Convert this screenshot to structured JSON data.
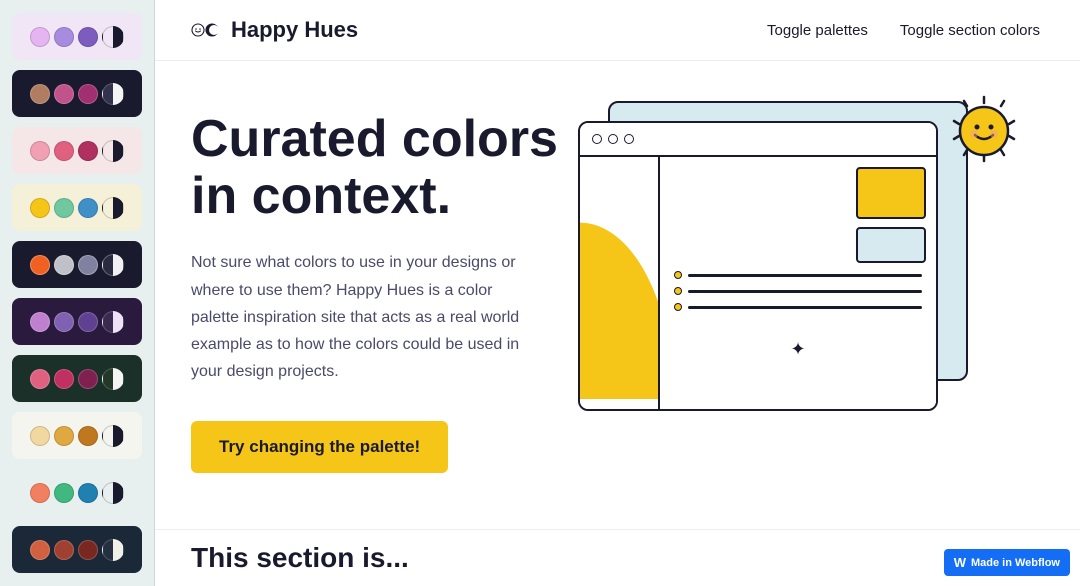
{
  "app": {
    "title": "Happy Hues",
    "logo_alt": "Happy Hues logo"
  },
  "header": {
    "toggle_palettes": "Toggle palettes",
    "toggle_colors": "Toggle section colors"
  },
  "hero": {
    "title_line1": "Curated colors",
    "title_line2": "in context.",
    "description": "Not sure what colors to use in your designs or where to use them? Happy Hues is a color palette inspiration site that acts as a real world example as to how the colors could be used in your design projects.",
    "cta_label": "Try changing the palette!"
  },
  "bottom": {
    "title": "This section is..."
  },
  "webflow_badge": "Made in Webflow",
  "palettes": [
    {
      "id": 1,
      "bg": "#f0e6f6",
      "swatches": [
        "#e4b5f0",
        "#a78bde",
        "#7c5cbf",
        "#1a1a2e"
      ],
      "active": false
    },
    {
      "id": 2,
      "bg": "#1a1a2e",
      "swatches": [
        "#b07d62",
        "#c0538a",
        "#a03070",
        "#f5f5f5"
      ],
      "active": false
    },
    {
      "id": 3,
      "bg": "#f5e6e8",
      "swatches": [
        "#f0a0b0",
        "#e06080",
        "#b03060",
        "#1a1a2e"
      ],
      "active": false
    },
    {
      "id": 4,
      "bg": "#f5f0d8",
      "swatches": [
        "#f5c518",
        "#70c8a0",
        "#4090c8",
        "#1a1a2e"
      ],
      "active": false
    },
    {
      "id": 5,
      "bg": "#1a1a2e",
      "swatches": [
        "#f06020",
        "#c0c0c8",
        "#8080a0",
        "#f0f0f5"
      ],
      "active": true
    },
    {
      "id": 6,
      "bg": "#2a1a3e",
      "swatches": [
        "#c080d0",
        "#8060b0",
        "#604090",
        "#f0e0f8"
      ],
      "active": false
    },
    {
      "id": 7,
      "bg": "#1a3028",
      "swatches": [
        "#e06080",
        "#c03060",
        "#802050",
        "#f5f5f5"
      ],
      "active": false
    },
    {
      "id": 8,
      "bg": "#f5f5f0",
      "swatches": [
        "#f0d8a0",
        "#e0a840",
        "#c07820",
        "#1a1a2e"
      ],
      "active": false
    },
    {
      "id": 9,
      "bg": "#e8f0ef",
      "swatches": [
        "#f08060",
        "#40b880",
        "#2080b0",
        "#1a1a2e"
      ],
      "active": false
    },
    {
      "id": 10,
      "bg": "#1a2838",
      "swatches": [
        "#d06040",
        "#a04030",
        "#782820",
        "#f0f0e8"
      ],
      "active": false
    }
  ],
  "icons": {
    "logo_happy": "☺",
    "logo_moon": "◑",
    "cursor": "↖",
    "crosshair": "✦",
    "webflow_w": "W"
  }
}
